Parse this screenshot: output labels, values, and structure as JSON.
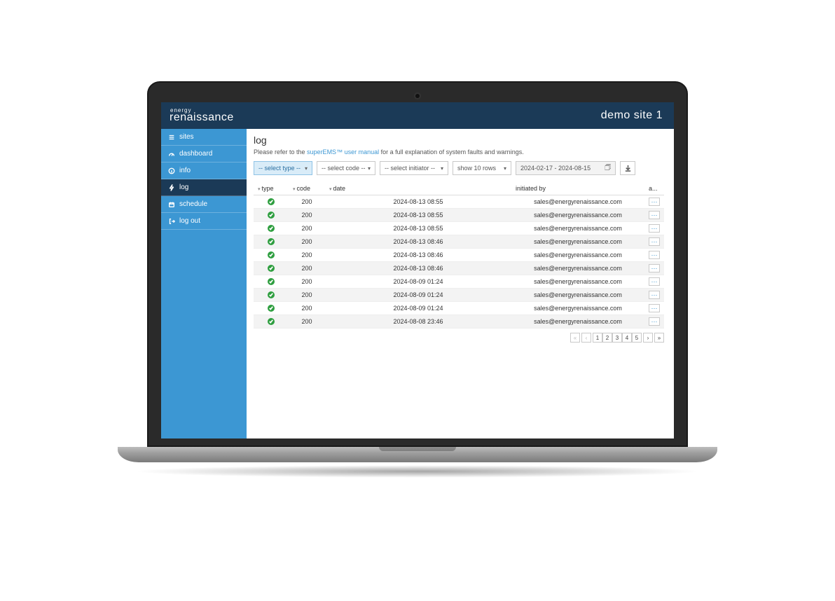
{
  "brand": {
    "top": "energy",
    "bottom": "renaissance"
  },
  "site_title": "demo site 1",
  "sidebar": {
    "items": [
      {
        "label": "sites"
      },
      {
        "label": "dashboard"
      },
      {
        "label": "info"
      },
      {
        "label": "log"
      },
      {
        "label": "schedule"
      },
      {
        "label": "log out"
      }
    ]
  },
  "page": {
    "title": "log",
    "help_prefix": "Please refer to the ",
    "help_link": "superEMS™ user manual",
    "help_suffix": " for a full explanation of system faults and warnings."
  },
  "filters": {
    "type": "-- select type --",
    "code": "-- select code --",
    "initiator": "-- select initiator --",
    "rows": "show 10 rows",
    "daterange": "2024-02-17 - 2024-08-15"
  },
  "table": {
    "headers": {
      "type": "type",
      "code": "code",
      "date": "date",
      "initiated_by": "initiated by",
      "actions": "a..."
    },
    "rows": [
      {
        "code": "200",
        "date": "2024-08-13 08:55",
        "initiated_by": "sales@energyrenaissance.com"
      },
      {
        "code": "200",
        "date": "2024-08-13 08:55",
        "initiated_by": "sales@energyrenaissance.com"
      },
      {
        "code": "200",
        "date": "2024-08-13 08:55",
        "initiated_by": "sales@energyrenaissance.com"
      },
      {
        "code": "200",
        "date": "2024-08-13 08:46",
        "initiated_by": "sales@energyrenaissance.com"
      },
      {
        "code": "200",
        "date": "2024-08-13 08:46",
        "initiated_by": "sales@energyrenaissance.com"
      },
      {
        "code": "200",
        "date": "2024-08-13 08:46",
        "initiated_by": "sales@energyrenaissance.com"
      },
      {
        "code": "200",
        "date": "2024-08-09 01:24",
        "initiated_by": "sales@energyrenaissance.com"
      },
      {
        "code": "200",
        "date": "2024-08-09 01:24",
        "initiated_by": "sales@energyrenaissance.com"
      },
      {
        "code": "200",
        "date": "2024-08-09 01:24",
        "initiated_by": "sales@energyrenaissance.com"
      },
      {
        "code": "200",
        "date": "2024-08-08 23:46",
        "initiated_by": "sales@energyrenaissance.com"
      }
    ]
  },
  "pager": {
    "first": "«",
    "prev": "‹",
    "next": "›",
    "last": "»",
    "pages": [
      "1",
      "2",
      "3",
      "4",
      "5"
    ]
  },
  "row_action_glyph": "⋯"
}
